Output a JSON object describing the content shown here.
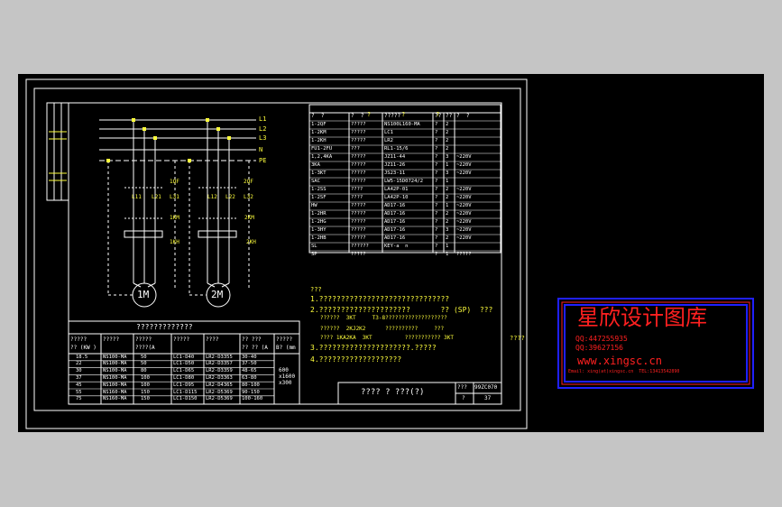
{
  "colors": {
    "background": "#c5c5c5",
    "paper": "#000000",
    "lines": "#ffffff",
    "text": "#ffff3c",
    "logo_border": "#2020ff",
    "logo_text": "#ff2020"
  },
  "circuit": {
    "bus_labels": [
      "L1",
      "L2",
      "L3",
      "N",
      "PE"
    ],
    "breakers": [
      "1QF",
      "2QF"
    ],
    "contactors_1": [
      "L11",
      "L21",
      "L31"
    ],
    "contactors_2": [
      "L12",
      "L22",
      "L32"
    ],
    "relays": [
      "1KM",
      "2KM",
      "1KH",
      "2KH"
    ],
    "motors": [
      "1M",
      "2M"
    ]
  },
  "parts_table": {
    "title_row": [
      "?",
      "?",
      "?"
    ],
    "header": [
      "?  ?",
      "?  ?",
      "?????",
      "??",
      "??",
      "?  ?"
    ],
    "rows": [
      [
        "1-2QF",
        "?????",
        "NS100L160-MA",
        "?",
        "2",
        ""
      ],
      [
        "1-2KM",
        "?????",
        "LC1",
        "?",
        "2",
        ""
      ],
      [
        "1-2KH",
        "?????",
        "LR2",
        "?",
        "2",
        ""
      ],
      [
        "FU1-2FU",
        "???",
        "RL1-15/6",
        "?",
        "2",
        ""
      ],
      [
        "1,2,4KA",
        "?????",
        "JZ11-44",
        "?",
        "3",
        "~220V"
      ],
      [
        "3KA",
        "?????",
        "JZ11-26",
        "?",
        "1",
        "~220V"
      ],
      [
        "1-3KT",
        "?????",
        "JS23-11",
        "?",
        "3",
        "~220V"
      ],
      [
        "SAC",
        "?????",
        "LW5-15D0724/2",
        "?",
        "1",
        ""
      ],
      [
        "1-2SS",
        "????",
        "LA42P-01",
        "?",
        "2",
        "~220V"
      ],
      [
        "1-2SF",
        "????",
        "LA42P-10",
        "?",
        "2",
        "~220V"
      ],
      [
        "HW",
        "?????",
        "AD17-16",
        "?",
        "1",
        "~220V"
      ],
      [
        "1-2HR",
        "?????",
        "AD17-16",
        "?",
        "2",
        "~220V"
      ],
      [
        "1-2HG",
        "?????",
        "AD17-16",
        "?",
        "2",
        "~220V"
      ],
      [
        "1-3HY",
        "?????",
        "AD17-16",
        "?",
        "3",
        "~220V"
      ],
      [
        "1-2HB",
        "?????",
        "AD17-16",
        "?",
        "2",
        "~220V"
      ],
      [
        "SL",
        "??????",
        "KEY-a  n",
        "?",
        "1",
        ""
      ],
      [
        "SP",
        "?????",
        "",
        "?",
        "1",
        "?????"
      ]
    ]
  },
  "notes": {
    "heading": "???",
    "lines": [
      "1.??????????????????????????????",
      "2.?????????????????????       ?? (SP)  ???",
      "   ??????  3KT     T3-8???????????????????",
      "   ??????  2KJ2K2      ??????????     ???",
      "   ???? 1KA2KA  3KT          ??????????? 3KT",
      "3.?????????????????????.?????",
      "4.???????????????????"
    ],
    "extra": "????"
  },
  "motor_table": {
    "title": "?????????????",
    "header": [
      "?????\n?? (KW )",
      "?????",
      "?????\n????(A",
      "?????",
      "????",
      "?? ???\n?? ?? (A",
      "?????\nB? (mm"
    ],
    "rows": [
      [
        "18.5",
        "NS100-MA",
        "50",
        "LC1-D40",
        "LR2-D3355",
        "30-40"
      ],
      [
        "22",
        "NS100-MA",
        "50",
        "LC1-D50",
        "LR2-D3357",
        "37-50"
      ],
      [
        "30",
        "NS100-MA",
        "80",
        "LC1-D65",
        "LR2-D3359",
        "48-65"
      ],
      [
        "37",
        "NS100-MA",
        "100",
        "LC1-D80",
        "LR2-D3363",
        "63-80"
      ],
      [
        "45",
        "NS100-MA",
        "100",
        "LC1-D95",
        "LR2-D4365",
        "80-100"
      ],
      [
        "55",
        "NS160-MA",
        "150",
        "LC1-D115",
        "LR2-D5369",
        "90-150"
      ],
      [
        "75",
        "NS160-MA",
        "150",
        "LC1-D150",
        "LR2-D5369",
        "100-160"
      ]
    ],
    "size_note": [
      "600",
      "x1600",
      "x300"
    ]
  },
  "title_block": {
    "title": "???? ? ???(?)",
    "code_label": "???",
    "code": "99ZC070",
    "sheet_label": "?",
    "sheet": "37"
  },
  "logo": {
    "name": "星欣设计图库",
    "qq1": "QQ:447255935",
    "qq2": "QQ:39627156",
    "url": "www.xingsc.cn",
    "email": "Email: xing(at)xingsc.cn  TEL:13413542890"
  }
}
